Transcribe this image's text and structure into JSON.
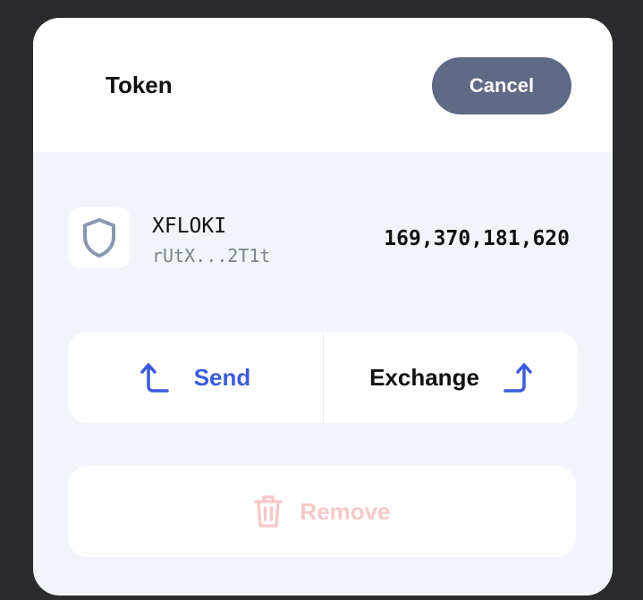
{
  "header": {
    "title": "Token",
    "cancel_label": "Cancel"
  },
  "token": {
    "icon": "shield-icon",
    "name": "XFLOKI",
    "address": "rUtX...2T1t",
    "balance": "169,370,181,620"
  },
  "actions": {
    "send_label": "Send",
    "send_icon": "arrow-up-left-icon",
    "exchange_label": "Exchange",
    "exchange_icon": "arrow-up-right-icon",
    "remove_label": "Remove",
    "remove_icon": "trash-icon"
  },
  "colors": {
    "accent": "#3b5bdb",
    "cancel_bg": "#5f6a86",
    "remove_disabled": "#f6c9c9",
    "panel_bg": "#f1f5fa"
  }
}
